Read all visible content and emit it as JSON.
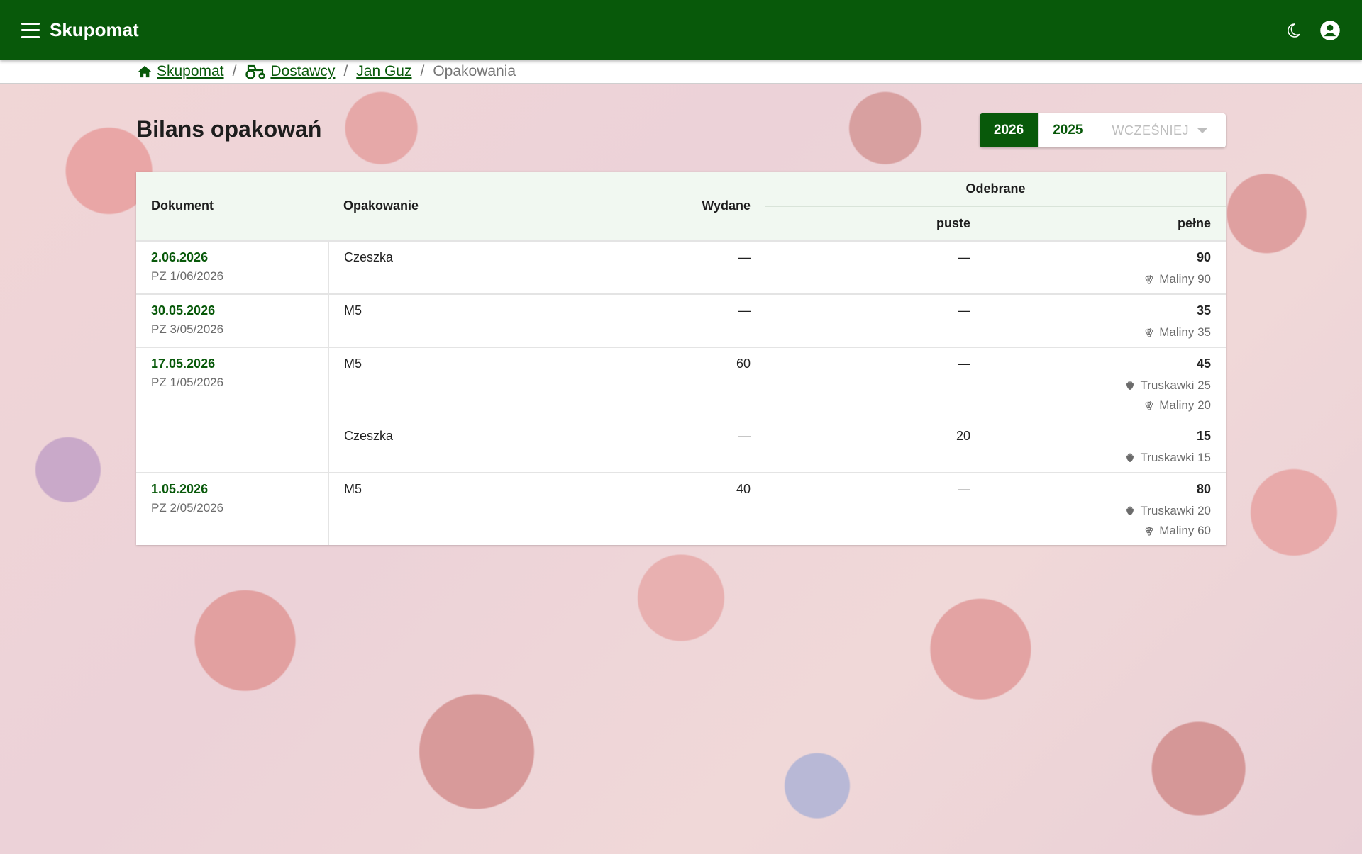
{
  "app": {
    "title": "Skupomat"
  },
  "breadcrumb": {
    "items": [
      {
        "label": "Skupomat",
        "icon": "home-icon"
      },
      {
        "label": "Dostawcy",
        "icon": "tractor-icon"
      },
      {
        "label": "Jan Guz"
      }
    ],
    "current": "Opakowania",
    "separator": "/"
  },
  "page": {
    "title": "Bilans opakowań"
  },
  "years": {
    "active": "2026",
    "other": "2025",
    "earlier": "WCZEŚNIEJ"
  },
  "table": {
    "headers": {
      "dokument": "Dokument",
      "opakowanie": "Opakowanie",
      "wydane": "Wydane",
      "odebrane": "Odebrane",
      "puste": "puste",
      "pelne": "pełne"
    },
    "rows": [
      {
        "date": "2.06.2026",
        "doc": "PZ 1/06/2026",
        "items": [
          {
            "opakowanie": "Czeszka",
            "wydane": "—",
            "puste": "—",
            "pelne": "90",
            "fruits": [
              {
                "icon": "raspberry-icon",
                "text": "Maliny 90"
              }
            ]
          }
        ]
      },
      {
        "date": "30.05.2026",
        "doc": "PZ 3/05/2026",
        "items": [
          {
            "opakowanie": "M5",
            "wydane": "—",
            "puste": "—",
            "pelne": "35",
            "fruits": [
              {
                "icon": "raspberry-icon",
                "text": "Maliny 35"
              }
            ]
          }
        ]
      },
      {
        "date": "17.05.2026",
        "doc": "PZ 1/05/2026",
        "items": [
          {
            "opakowanie": "M5",
            "wydane": "60",
            "puste": "—",
            "pelne": "45",
            "fruits": [
              {
                "icon": "strawberry-icon",
                "text": "Truskawki 25"
              },
              {
                "icon": "raspberry-icon",
                "text": "Maliny 20"
              }
            ]
          },
          {
            "opakowanie": "Czeszka",
            "wydane": "—",
            "puste": "20",
            "pelne": "15",
            "fruits": [
              {
                "icon": "strawberry-icon",
                "text": "Truskawki 15"
              }
            ]
          }
        ]
      },
      {
        "date": "1.05.2026",
        "doc": "PZ 2/05/2026",
        "items": [
          {
            "opakowanie": "M5",
            "wydane": "40",
            "puste": "—",
            "pelne": "80",
            "fruits": [
              {
                "icon": "strawberry-icon",
                "text": "Truskawki 20"
              },
              {
                "icon": "raspberry-icon",
                "text": "Maliny 60"
              }
            ]
          }
        ]
      }
    ]
  },
  "colors": {
    "primary": "#08590a",
    "header_bg": "#f1f8f1",
    "muted": "#6b6b6b"
  }
}
